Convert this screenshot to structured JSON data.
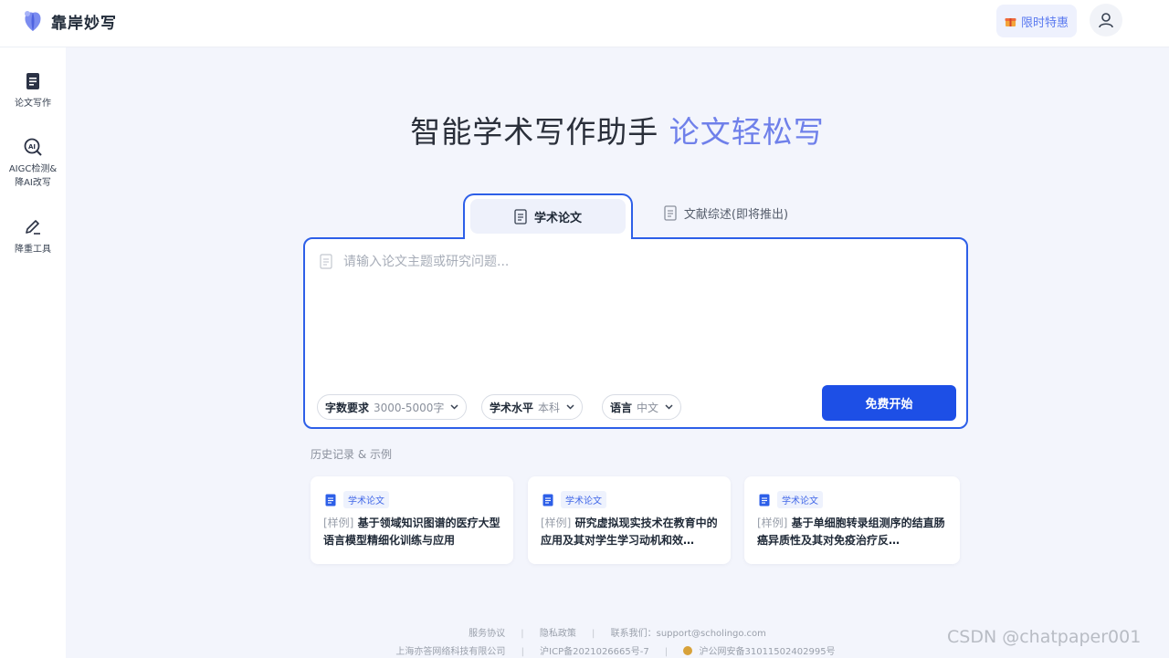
{
  "header": {
    "app_name": "靠岸妙写",
    "promo_label": "限时特惠",
    "brand_color": "#6f80ea",
    "accent_blue": "#1d4fe6"
  },
  "sidebar": {
    "items": [
      {
        "label_lines": [
          "论文写作"
        ],
        "icon": "document-icon"
      },
      {
        "label_lines": [
          "AIGC检测&",
          "降AI改写"
        ],
        "icon": "ai-scan-icon"
      },
      {
        "label_lines": [
          "降重工具"
        ],
        "icon": "pen-icon"
      }
    ]
  },
  "hero": {
    "title_main": "智能学术写作助手",
    "title_accent": "论文轻松写"
  },
  "tabs": [
    {
      "label": "学术论文",
      "active": true,
      "icon": "document-icon"
    },
    {
      "label": "文献综述(即将推出)",
      "active": false,
      "icon": "document-icon"
    }
  ],
  "editor": {
    "placeholder": "请输入论文主题或研究问题...",
    "value": ""
  },
  "options": [
    {
      "key": "字数要求",
      "value": "3000-5000字"
    },
    {
      "key": "学术水平",
      "value": "本科"
    },
    {
      "key": "语言",
      "value": "中文"
    }
  ],
  "start_button": "免费开始",
  "history": {
    "title": "历史记录 & 示例",
    "cards": [
      {
        "tag": "学术论文",
        "prefix": "[样例]",
        "title": "基于领域知识图谱的医疗大型语言模型精细化训练与应用"
      },
      {
        "tag": "学术论文",
        "prefix": "[样例]",
        "title": "研究虚拟现实技术在教育中的应用及其对学生学习动机和效…"
      },
      {
        "tag": "学术论文",
        "prefix": "[样例]",
        "title": "基于单细胞转录组测序的结直肠癌异质性及其对免疫治疗反…"
      }
    ]
  },
  "footer": {
    "links": [
      "服务协议",
      "隐私政策",
      "联系我们：support@scholingo.com"
    ],
    "company": "上海亦答网络科技有限公司",
    "icp": "沪ICP备2021026665号-7",
    "police": "沪公网安备31011502402995号"
  },
  "watermark": "CSDN @chatpaper001"
}
